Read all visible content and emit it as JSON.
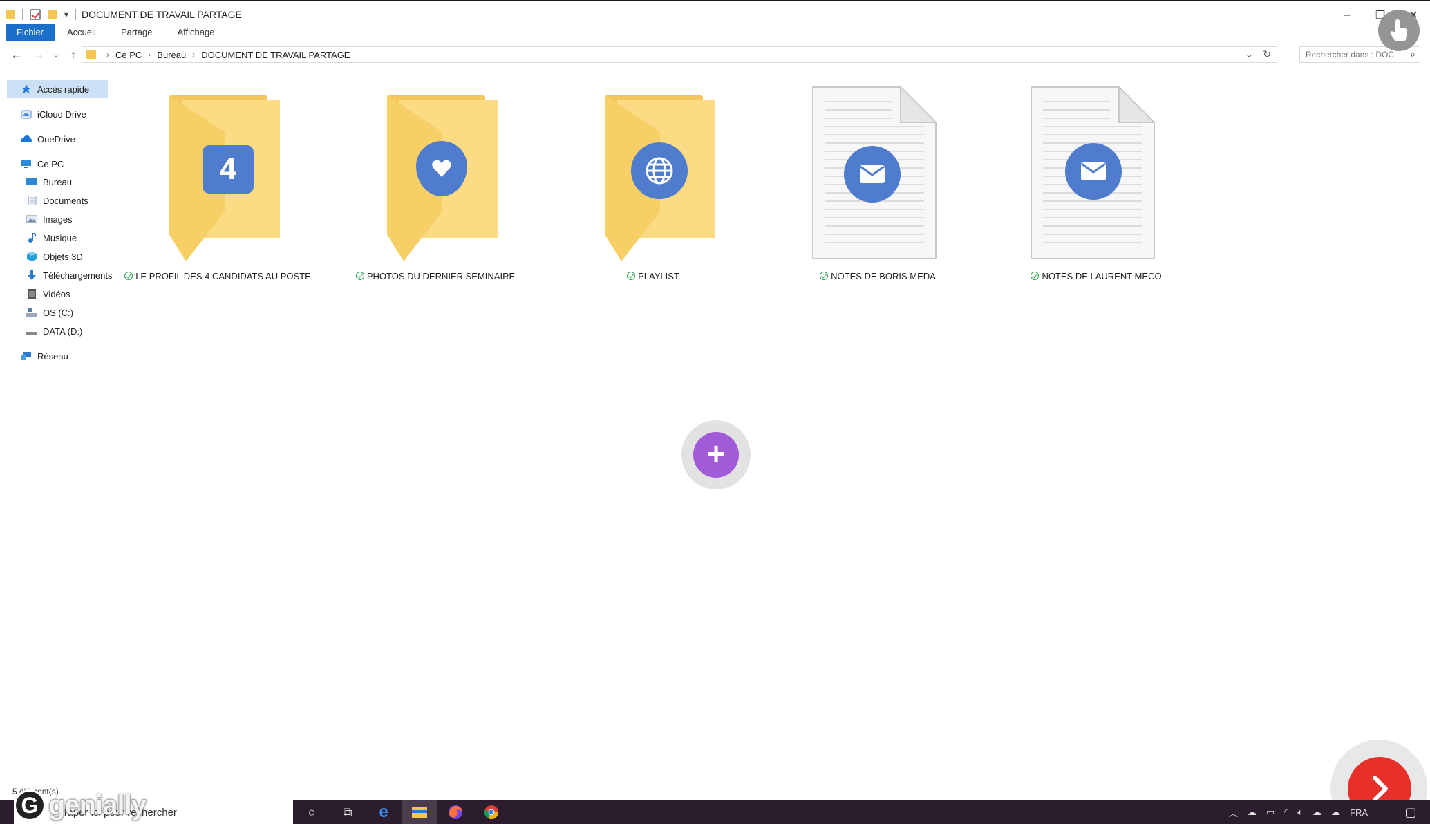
{
  "window": {
    "title": "DOCUMENT DE TRAVAIL PARTAGE",
    "controls": {
      "minimize": "–",
      "restore": "❐",
      "close": "✕"
    }
  },
  "ribbon": {
    "tabs": [
      "Fichier",
      "Accueil",
      "Partage",
      "Affichage"
    ]
  },
  "address": {
    "crumbs": [
      "Ce PC",
      "Bureau",
      "DOCUMENT DE TRAVAIL PARTAGE"
    ],
    "search_placeholder": "Rechercher dans : DOC..."
  },
  "sidebar": {
    "items": [
      {
        "label": "Accès rapide",
        "icon": "star-icon",
        "color": "#2a7ad5"
      },
      {
        "label": "iCloud Drive",
        "icon": "icloud-icon",
        "color": "#4a8ad9"
      },
      {
        "label": "OneDrive",
        "icon": "cloud-icon",
        "color": "#1976d2"
      },
      {
        "label": "Ce PC",
        "icon": "computer-icon",
        "color": "#2b8ad8"
      },
      {
        "label": "Bureau",
        "icon": "desktop-icon",
        "color": "#2b8ad8"
      },
      {
        "label": "Documents",
        "icon": "documents-icon",
        "color": "#8aa0b8"
      },
      {
        "label": "Images",
        "icon": "images-icon",
        "color": "#6f8aa6"
      },
      {
        "label": "Musique",
        "icon": "music-icon",
        "color": "#2b7ad0"
      },
      {
        "label": "Objets 3D",
        "icon": "cube-icon",
        "color": "#28a0d8"
      },
      {
        "label": "Téléchargements",
        "icon": "download-icon",
        "color": "#2b7ad0"
      },
      {
        "label": "Vidéos",
        "icon": "video-icon",
        "color": "#555555"
      },
      {
        "label": "OS (C:)",
        "icon": "drive-c-icon",
        "color": "#5a7da6"
      },
      {
        "label": "DATA (D:)",
        "icon": "drive-d-icon",
        "color": "#666666"
      },
      {
        "label": "Réseau",
        "icon": "network-icon",
        "color": "#2b7ad0"
      }
    ]
  },
  "items": [
    {
      "label": "LE PROFIL DES 4 CANDIDATS AU POSTE",
      "kind": "folder",
      "badge": "4"
    },
    {
      "label": "PHOTOS DU DERNIER SEMINAIRE",
      "kind": "folder",
      "badge": "heart-icon"
    },
    {
      "label": "PLAYLIST",
      "kind": "folder",
      "badge": "globe-icon"
    },
    {
      "label": "NOTES DE BORIS MEDA",
      "kind": "document",
      "badge": "mail-icon"
    },
    {
      "label": "NOTES DE LAURENT MECO",
      "kind": "document",
      "badge": "mail-icon"
    }
  ],
  "status": {
    "count": "5 élément(s)"
  },
  "taskbar": {
    "search_placeholder": "Taper ici pour rechercher",
    "language": "FRA"
  },
  "branding": {
    "logo": "G",
    "word": "genially"
  },
  "colors": {
    "accent": "#1a6fc9",
    "badge": "#4f7ccc",
    "add_button": "#a15ad8",
    "next_button": "#e8302a",
    "sync_ok": "#27a04a"
  }
}
